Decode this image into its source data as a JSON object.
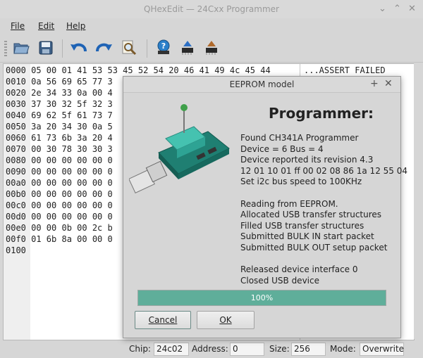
{
  "window": {
    "title": "QHexEdit — 24Cxx Programmer",
    "controls": [
      "⌄",
      "⌃",
      "✕"
    ]
  },
  "menubar": {
    "file": "File",
    "edit": "Edit",
    "help": "Help"
  },
  "toolbar": [
    "open-icon",
    "save-icon",
    "undo-icon",
    "redo-icon",
    "find-icon",
    "about-icon",
    "read-eeprom-icon",
    "write-eeprom-icon"
  ],
  "hex": {
    "rows": [
      "0000 05 00 01 41 53 53 45 52 54 20 46 41 49 4c 45 44",
      "0010 0a 56 69 65 77 3",
      "0020 2e 34 33 0a 00 4",
      "0030 37 30 32 5f 32 3",
      "0040 69 62 5f 61 73 7",
      "0050 3a 20 34 30 0a 5",
      "0060 61 73 6b 3a 20 4",
      "0070 00 30 78 30 30 3",
      "0080 00 00 00 00 00 0",
      "0090 00 00 00 00 00 0",
      "00a0 00 00 00 00 00 0",
      "00b0 00 00 00 00 00 0",
      "00c0 00 00 00 00 00 0",
      "00d0 00 00 00 00 00 0",
      "00e0 00 00 0b 00 2c b",
      "00f0 01 6b 8a 00 00 0",
      "0100"
    ],
    "ascii_first": "...ASSERT FAILED"
  },
  "status": {
    "chip_label": "Chip:",
    "chip_value": "24c02",
    "address_label": "Address:",
    "address_value": "0",
    "size_label": "Size:",
    "size_value": "256",
    "mode_label": "Mode:",
    "mode_value": "Overwrite"
  },
  "dialog": {
    "title": "EEPROM model",
    "controls": [
      "+",
      "✕"
    ],
    "heading": "Programmer:",
    "log": [
      "Found CH341A Programmer",
      "Device = 6  Bus = 4",
      "Device reported its revision 4.3",
      "12 01 10 01 ff 00 02 08 86 1a 12 55 04",
      "Set i2c bus speed to 100KHz",
      "",
      "Reading from EEPROM.",
      "Allocated USB transfer structures",
      "Filled USB transfer structures",
      "Submitted BULK IN start packet",
      "Submitted BULK OUT setup packet",
      "",
      "Released device interface 0",
      "Closed USB device"
    ],
    "progress_value": 1.0,
    "progress_text": "100%",
    "cancel_label": "Cancel",
    "ok_label": "OK"
  }
}
